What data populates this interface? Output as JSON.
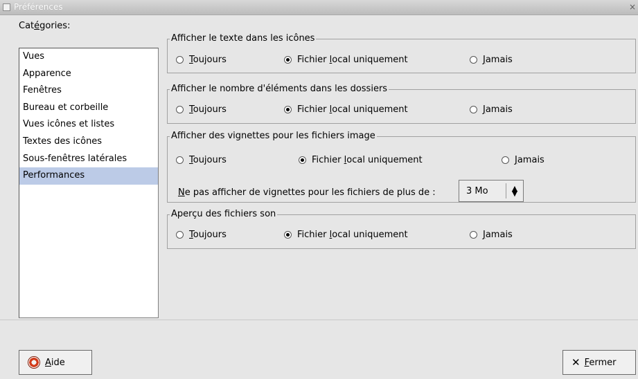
{
  "window": {
    "title": "Préférences",
    "close_glyph": "×"
  },
  "categories": {
    "label_pre": "Cat",
    "label_mnemonic": "é",
    "label_post": "gories:",
    "items": [
      {
        "label": "Vues"
      },
      {
        "label": "Apparence"
      },
      {
        "label": "Fenêtres"
      },
      {
        "label": "Bureau et corbeille"
      },
      {
        "label": "Vues icônes et listes"
      },
      {
        "label": "Textes des icônes"
      },
      {
        "label": "Sous-fenêtres latérales"
      },
      {
        "label": "Performances",
        "selected": true
      }
    ]
  },
  "options": {
    "toujours_mnemonic": "T",
    "toujours_rest": "oujours",
    "local_pre": "Fichier ",
    "local_mnemonic": "l",
    "local_post": "ocal uniquement",
    "jamais_mnemonic": "J",
    "jamais_rest": "amais"
  },
  "groups": [
    {
      "title": "Afficher le texte dans les icônes",
      "selected": "local"
    },
    {
      "title": "Afficher le nombre d'éléments dans les dossiers",
      "selected": "local"
    },
    {
      "title": "Afficher des vignettes pour les fichiers image",
      "selected": "local",
      "size_label_mnemonic": "N",
      "size_label_rest": "e pas afficher de vignettes pour les fichiers de plus de :",
      "size_value": "3 Mo"
    },
    {
      "title": "Aperçu des fichiers son",
      "selected": "local"
    }
  ],
  "buttons": {
    "help_mnemonic": "A",
    "help_rest": "ide",
    "close_mnemonic": "F",
    "close_rest": "ermer"
  },
  "icons": {
    "help": "lifebuoy-icon",
    "close": "x-icon"
  }
}
